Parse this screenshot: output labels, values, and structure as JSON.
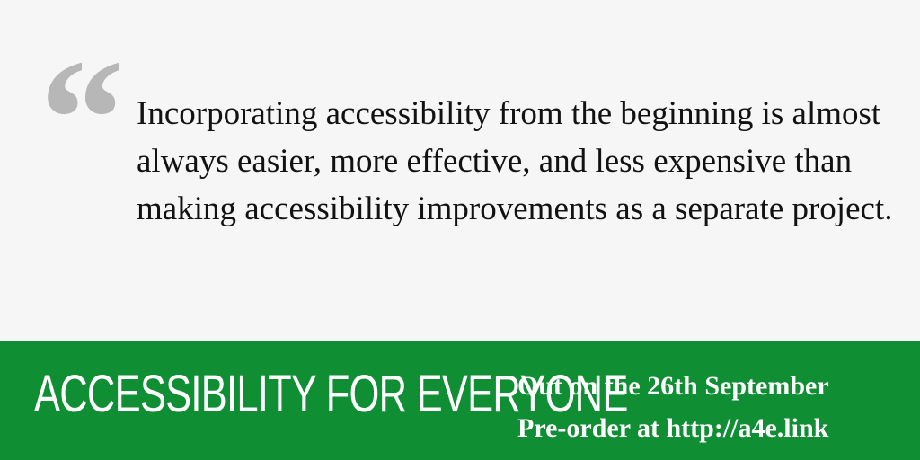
{
  "quote": {
    "mark": "“",
    "text": "Incorporating accessibility from the beginning is almost always easier, more effective, and less expensive than making accessibility improvements as a separate project."
  },
  "banner": {
    "title": "ACCESSIBILITY FOR EVERYONE",
    "release_line": "Out on the 26th September",
    "preorder_line": "Pre-order at http://a4e.link"
  },
  "colors": {
    "banner_background": "#0f8e34",
    "quote_background": "#f6f6f6",
    "quote_mark": "#b7b7b7",
    "text": "#121212"
  }
}
